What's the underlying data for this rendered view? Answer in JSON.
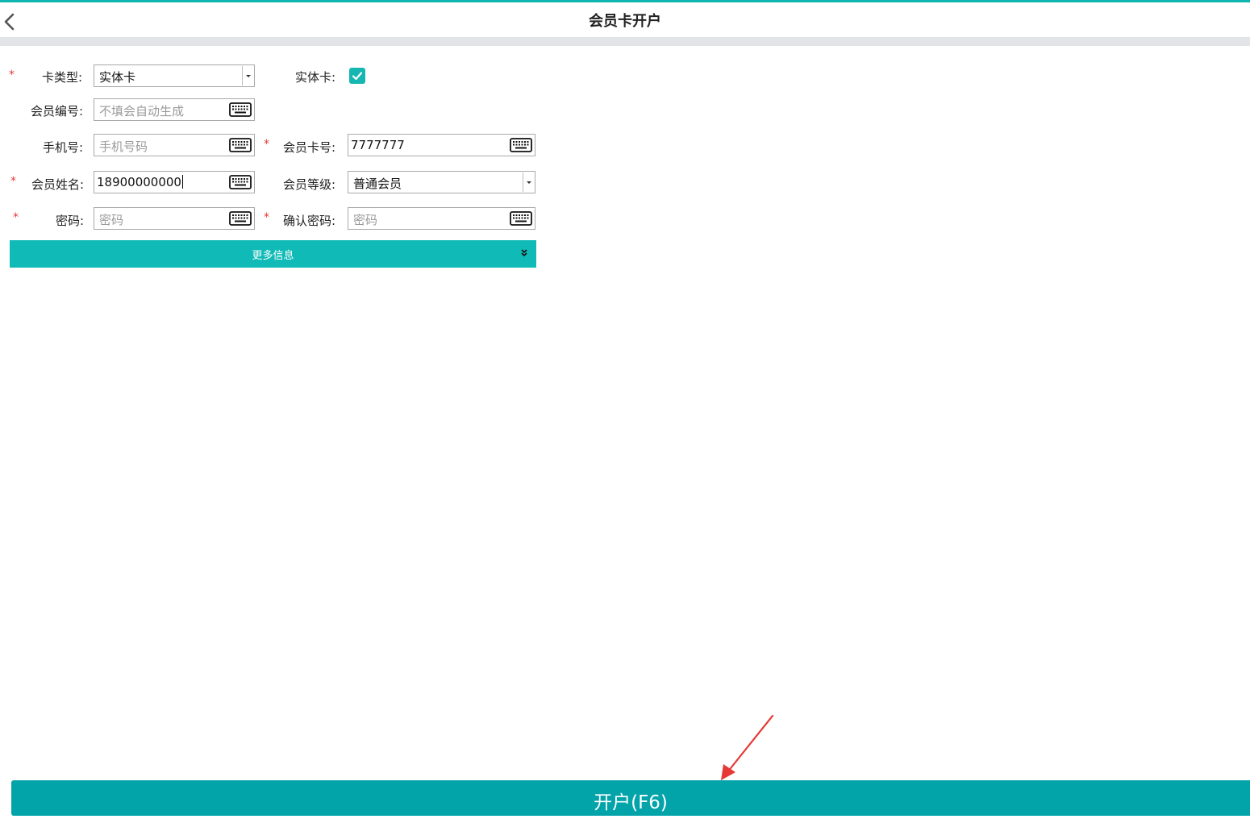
{
  "header": {
    "title": "会员卡开户"
  },
  "form": {
    "card_type": {
      "label": "卡类型:",
      "value": "实体卡",
      "required_mark": "*"
    },
    "physical_card": {
      "label": "实体卡:",
      "checked": true
    },
    "member_no": {
      "label": "会员编号:",
      "placeholder": "不填会自动生成"
    },
    "phone": {
      "label": "手机号:",
      "placeholder": "手机号码"
    },
    "card_no": {
      "label": "会员卡号:",
      "value": "7777777",
      "required_mark": "*"
    },
    "name": {
      "label": "会员姓名:",
      "value": "18900000000",
      "required_mark": "*"
    },
    "level": {
      "label": "会员等级:",
      "value": "普通会员"
    },
    "password": {
      "label": "密码:",
      "placeholder": "密码",
      "required_mark": "*"
    },
    "confirm_password": {
      "label": "确认密码:",
      "placeholder": "密码",
      "required_mark": "*"
    }
  },
  "more_info": {
    "label": "更多信息"
  },
  "submit": {
    "label": "开户(F6)"
  },
  "colors": {
    "accent": "#10bab6",
    "submit": "#02a4aa",
    "required": "#e53935",
    "annotation": "#e53935"
  },
  "icons": [
    "back-arrow-icon",
    "keyboard-icon",
    "check-icon",
    "dropdown-arrow-icon",
    "double-chevron-down-icon"
  ]
}
